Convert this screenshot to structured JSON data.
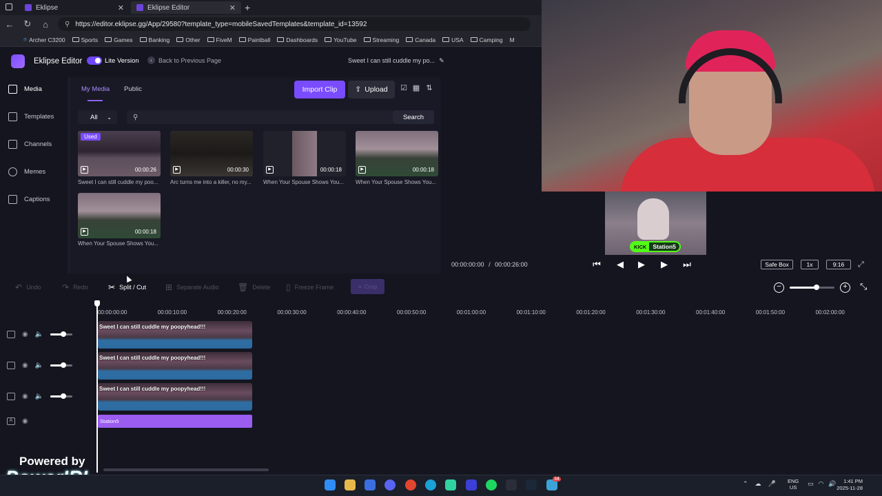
{
  "browser": {
    "tabs": [
      {
        "title": "Eklipse"
      },
      {
        "title": "Eklipse Editor"
      }
    ],
    "url": "https://editor.eklipse.gg/App/29580?template_type=mobileSavedTemplates&template_id=13592",
    "bookmarks": [
      "Archer C3200",
      "Sports",
      "Games",
      "Banking",
      "Other",
      "FiveM",
      "Paintball",
      "Dashboards",
      "YouTube",
      "Streaming",
      "Canada",
      "USA",
      "Camping",
      "M"
    ]
  },
  "header": {
    "app_title": "Eklipse Editor",
    "lite_label": "Lite Version",
    "lite_enabled": true,
    "back_label": "Back to Previous Page",
    "project_title": "Sweet I can still cuddle my po...",
    "edit_icon": "pencil-icon"
  },
  "nav": {
    "items": [
      {
        "label": "Media",
        "icon": "layers-icon"
      },
      {
        "label": "Templates",
        "icon": "template-icon"
      },
      {
        "label": "Channels",
        "icon": "channels-icon"
      },
      {
        "label": "Memes",
        "icon": "memes-icon"
      },
      {
        "label": "Captions",
        "icon": "captions-icon"
      }
    ]
  },
  "media": {
    "tabs": [
      "My Media",
      "Public"
    ],
    "import_label": "Import Clip",
    "upload_label": "Upload",
    "filter_value": "All",
    "search_placeholder": "",
    "search_label": "Search",
    "used_label": "Used",
    "clips": [
      {
        "duration": "00:00:26",
        "title": "Sweet I can still cuddle my poo..."
      },
      {
        "duration": "00:00:30",
        "title": "Arc turns me into a killer, no my..."
      },
      {
        "duration": "00:00:18",
        "title": "When Your Spouse Shows You..."
      },
      {
        "duration": "00:00:18",
        "title": "When Your Spouse Shows You..."
      },
      {
        "duration": "00:00:18",
        "title": "When Your Spouse Shows You..."
      }
    ]
  },
  "preview": {
    "kick_logo": "KICK",
    "channel": "Station5",
    "current_time": "00:00:00:00",
    "separator": "/",
    "total_time": "00:00:26:00",
    "safe_box_label": "Safe Box",
    "speed_label": "1x",
    "ratio_label": "9:16"
  },
  "toolbar": {
    "undo": "Undo",
    "redo": "Redo",
    "split": "Split / Cut",
    "separate_audio": "Separate Audio",
    "delete": "Delete",
    "freeze": "Freeze Frame",
    "crop": "Crop",
    "zoom_level": 0.6
  },
  "timeline": {
    "ruler": [
      "00:00:00:00",
      "00:00:10:00",
      "00:00:20:00",
      "00:00:30:00",
      "00:00:40:00",
      "00:00:50:00",
      "00:01:00:00",
      "00:01:10:00",
      "00:01:20:00",
      "00:01:30:00",
      "00:01:40:00",
      "00:01:50:00",
      "00:02:00:00"
    ],
    "tracks": [
      {
        "caption": "Sweet I can still cuddle my poopyhead!!!",
        "volume": 0.6
      },
      {
        "caption": "Sweet I can still cuddle my poopyhead!!!",
        "volume": 0.6
      },
      {
        "caption": "Sweet I can still cuddle my poopyhead!!!",
        "volume": 0.6
      }
    ],
    "text_track": "Station5"
  },
  "branding": {
    "powered_by": "Powered by",
    "brand": "PowerIRL"
  },
  "taskbar": {
    "lang_1": "ENG",
    "lang_2": "US",
    "time": "1:41 PM",
    "date": "2025-11-28",
    "badge_count": "34",
    "colors": {
      "accent": "#7a4cff",
      "kick_green": "#53fc18",
      "text_clip": "#9b5cf0"
    }
  }
}
